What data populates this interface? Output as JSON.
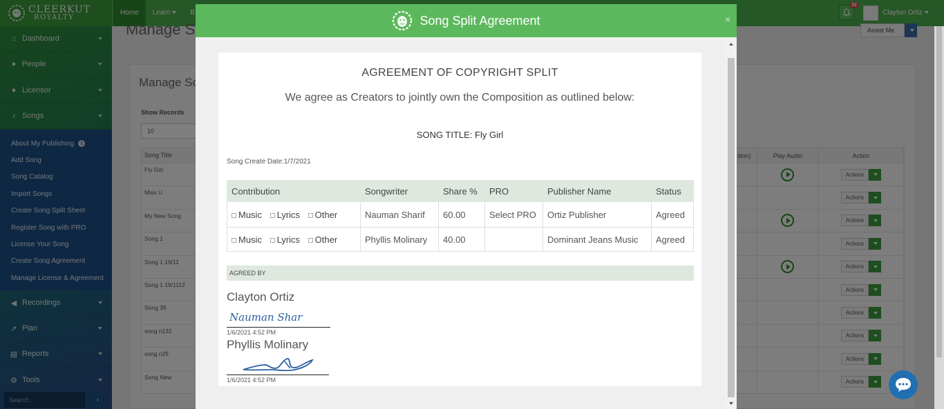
{
  "brand": {
    "line1": "CLEERKUT",
    "line2": "ROYALTY"
  },
  "topnav": [
    {
      "label": "Home",
      "active": true
    },
    {
      "label": "Learn",
      "caret": true
    },
    {
      "label": "B"
    }
  ],
  "header": {
    "notification_count": "32",
    "user_name": "Clayton Ortiz"
  },
  "sidebar": {
    "items": [
      {
        "label": "Dashboard",
        "icon": "home-icon"
      },
      {
        "label": "People",
        "icon": "users-icon"
      },
      {
        "label": "Licensor",
        "icon": "users-icon"
      },
      {
        "label": "Songs",
        "icon": "music-note-icon"
      },
      {
        "label": "Recordings",
        "icon": "volume-icon"
      },
      {
        "label": "Plan",
        "icon": "rocket-icon"
      },
      {
        "label": "Reports",
        "icon": "book-icon"
      },
      {
        "label": "Tools",
        "icon": "cogs-icon"
      }
    ],
    "songs_submenu": [
      "About My Publishing",
      "Add Song",
      "Song Catalog",
      "Import Songs",
      "Create Song Split Sheet",
      "Register Song with PRO",
      "License Your Song",
      "Create Song Agreement",
      "Manage License & Agreement"
    ],
    "search_placeholder": "Search..."
  },
  "page": {
    "title": "Manage So",
    "assist_label": "Assist Me",
    "card_title": "Manage So",
    "show_records_label": "Show Records",
    "records_value": "10",
    "table_left_header": "Song Title",
    "song_titles": [
      "Fly Girl",
      "Miss U",
      "My New Song",
      "Song 1",
      "Song 1 19/11",
      "Song 1 19/1112",
      "Song 36",
      "song n132",
      "song n25",
      "Song New"
    ],
    "table_right_headers": [
      "ition)",
      "Play Audio",
      "Action"
    ],
    "play_rows": [
      true,
      false,
      true,
      false,
      true,
      false,
      false,
      false,
      false,
      false
    ],
    "actions_label": "Actions"
  },
  "modal": {
    "title": "Song Split Agreement",
    "close": "×",
    "heading": "AGREEMENT OF COPYRIGHT SPLIT",
    "subheading": "We agree as Creators to jointly own the Composition as outlined below:",
    "song_title": "SONG TITLE: Fly Girl",
    "create_date": "Song Create Date:1/7/2021",
    "table_headers": [
      "Contribution",
      "Songwriter",
      "Share %",
      "PRO",
      "Publisher Name",
      "Status"
    ],
    "contribution_options": [
      "Music",
      "Lyrics",
      "Other"
    ],
    "rows": [
      {
        "songwriter": "Nauman Sharif",
        "share": "60.00",
        "pro": "Select PRO",
        "publisher": "Ortiz Publisher",
        "status": "Agreed"
      },
      {
        "songwriter": "Phyllis Molinary",
        "share": "40.00",
        "pro": "",
        "publisher": "Dominant Jeans Music",
        "status": "Agreed"
      }
    ],
    "agreed_by_label": "AGREED BY",
    "signers": [
      {
        "name": "Clayton Ortiz",
        "signature": "Nauman Sharif",
        "date": "1/6/2021 4:52 PM"
      },
      {
        "name": "Phyllis Molinary",
        "signature": "",
        "date": "1/6/2021 4:52 PM"
      }
    ]
  },
  "colors": {
    "brand_green": "#5cb85c",
    "topbar_green": "#4cae4c",
    "submenu_blue": "#1d4f86",
    "table_header_bg": "#dfe8df",
    "chat_blue": "#1f6fb2"
  }
}
